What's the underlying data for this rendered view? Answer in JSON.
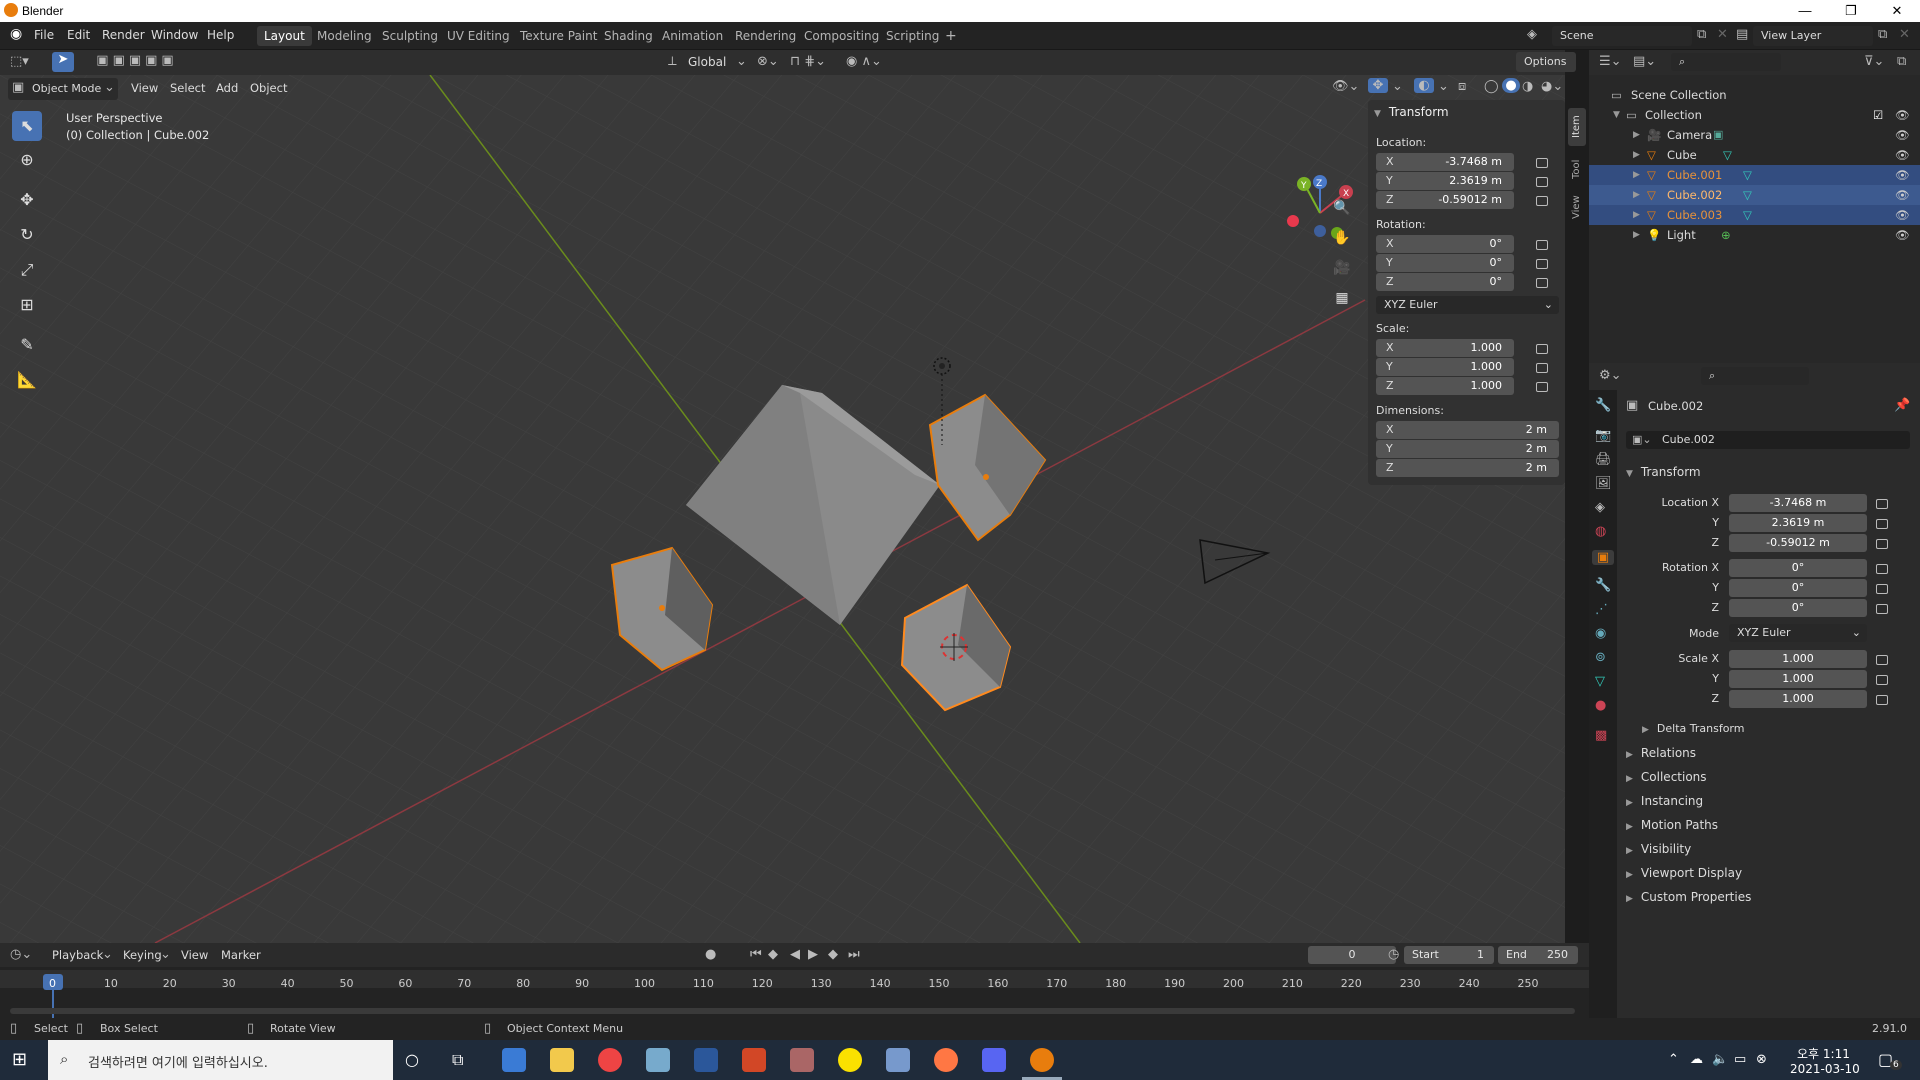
{
  "window": {
    "title": "Blender"
  },
  "menu": {
    "items": [
      "File",
      "Edit",
      "Render",
      "Window",
      "Help"
    ]
  },
  "workspaces": {
    "tabs": [
      "Layout",
      "Modeling",
      "Sculpting",
      "UV Editing",
      "Texture Paint",
      "Shading",
      "Animation",
      "Rendering",
      "Compositing",
      "Scripting"
    ],
    "active": "Layout",
    "add": "+"
  },
  "scene": {
    "name": "Scene",
    "view_layer": "View Layer"
  },
  "header": {
    "orientation": "Global",
    "options": "Options"
  },
  "viewport_menu": {
    "mode": "Object Mode",
    "items": [
      "View",
      "Select",
      "Add",
      "Object"
    ]
  },
  "viewport": {
    "perspective": "User Perspective",
    "context": "(0) Collection | Cube.002"
  },
  "npanel": {
    "title": "Transform",
    "tabs": [
      "Item",
      "Tool",
      "View"
    ],
    "location_label": "Location:",
    "location": [
      {
        "k": "X",
        "v": "-3.7468 m"
      },
      {
        "k": "Y",
        "v": "2.3619 m"
      },
      {
        "k": "Z",
        "v": "-0.59012 m"
      }
    ],
    "rotation_label": "Rotation:",
    "rotation": [
      {
        "k": "X",
        "v": "0°"
      },
      {
        "k": "Y",
        "v": "0°"
      },
      {
        "k": "Z",
        "v": "0°"
      }
    ],
    "rotation_mode": "XYZ Euler",
    "scale_label": "Scale:",
    "scale": [
      {
        "k": "X",
        "v": "1.000"
      },
      {
        "k": "Y",
        "v": "1.000"
      },
      {
        "k": "Z",
        "v": "1.000"
      }
    ],
    "dimensions_label": "Dimensions:",
    "dimensions": [
      {
        "k": "X",
        "v": "2 m"
      },
      {
        "k": "Y",
        "v": "2 m"
      },
      {
        "k": "Z",
        "v": "2 m"
      }
    ]
  },
  "outliner": {
    "root": "Scene Collection",
    "collection": "Collection",
    "items": [
      {
        "name": "Camera",
        "selected": false
      },
      {
        "name": "Cube",
        "selected": false
      },
      {
        "name": "Cube.001",
        "selected": true
      },
      {
        "name": "Cube.002",
        "selected": true
      },
      {
        "name": "Cube.003",
        "selected": true
      },
      {
        "name": "Light",
        "selected": false
      }
    ]
  },
  "properties": {
    "object_name": "Cube.002",
    "datablock": "Cube.002",
    "transform_title": "Transform",
    "location_x_label": "Location X",
    "location": [
      "-3.7468 m",
      "2.3619 m",
      "-0.59012 m"
    ],
    "rotation_x_label": "Rotation X",
    "rotation": [
      "0°",
      "0°",
      "0°"
    ],
    "mode_label": "Mode",
    "mode": "XYZ Euler",
    "scale_x_label": "Scale X",
    "scale": [
      "1.000",
      "1.000",
      "1.000"
    ],
    "y_label": "Y",
    "z_label": "Z",
    "sections": [
      "Delta Transform",
      "Relations",
      "Collections",
      "Instancing",
      "Motion Paths",
      "Visibility",
      "Viewport Display",
      "Custom Properties"
    ]
  },
  "timeline": {
    "menus": [
      "Playback",
      "Keying",
      "View",
      "Marker"
    ],
    "current_frame": "0",
    "start_label": "Start",
    "start": "1",
    "end_label": "End",
    "end": "250",
    "ticks": [
      "0",
      "10",
      "20",
      "30",
      "40",
      "50",
      "60",
      "70",
      "80",
      "90",
      "100",
      "110",
      "120",
      "130",
      "140",
      "150",
      "160",
      "170",
      "180",
      "190",
      "200",
      "210",
      "220",
      "230",
      "240",
      "250"
    ]
  },
  "statusbar": {
    "select": "Select",
    "box_select": "Box Select",
    "rotate_view": "Rotate View",
    "context_menu": "Object Context Menu",
    "version": "2.91.0"
  },
  "taskbar": {
    "search_placeholder": "검색하려면 여기에 입력하십시오.",
    "time": "오후 1:11",
    "date": "2021-03-10",
    "notif": "6"
  },
  "colors": {
    "accent": "#e87d0d",
    "selection_blue": "#334d80",
    "active_frame": "#4772b3",
    "x_axis": "#a33a44",
    "y_axis": "#6f9a1c"
  }
}
